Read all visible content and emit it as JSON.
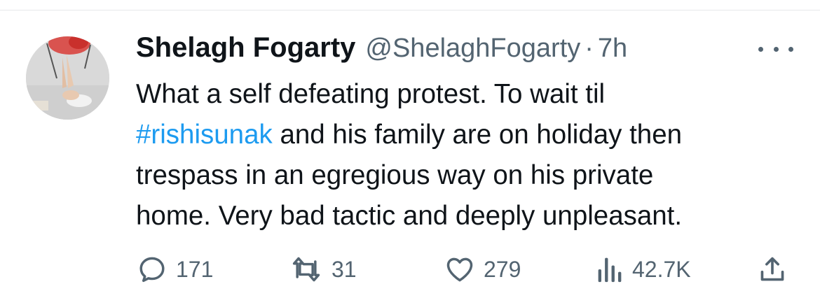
{
  "tweet": {
    "author_name": "Shelagh Fogarty",
    "author_handle": "@ShelaghFogarty",
    "separator": "·",
    "timestamp": "7h",
    "text_lines": [
      {
        "prefix": "",
        "hashtag": "",
        "rest": "What a self defeating protest. To wait til"
      },
      {
        "prefix": "",
        "hashtag": "#rishisunak",
        "rest": " and his family are on holiday then"
      },
      {
        "prefix": "",
        "hashtag": "",
        "rest": "trespass in an egregious way on his private"
      },
      {
        "prefix": "",
        "hashtag": "",
        "rest": "home. Very bad tactic and deeply unpleasant."
      }
    ]
  },
  "actions": {
    "replies": "171",
    "retweets": "31",
    "likes": "279",
    "views": "42.7K"
  },
  "icons": {
    "avatar": "avatar-image",
    "more": "more-icon",
    "reply": "reply-icon",
    "retweet": "retweet-icon",
    "like": "heart-icon",
    "views": "views-icon",
    "share": "share-icon"
  },
  "colors": {
    "text": "#0f1419",
    "secondary": "#536471",
    "hashtag": "#1d9bf0",
    "divider": "#e7e9ea"
  }
}
